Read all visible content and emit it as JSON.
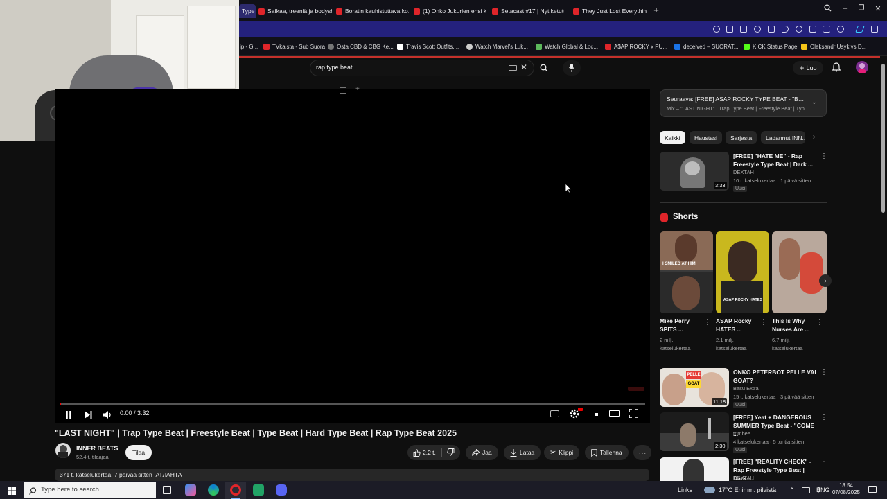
{
  "browser": {
    "tabs": [
      {
        "label": "Type",
        "active": true
      },
      {
        "label": "Safkaa, treeniä ja bodyshop"
      },
      {
        "label": "Boratin kauhistuttava ko..."
      },
      {
        "label": "(1) Onko Jukurien ensi ka..."
      },
      {
        "label": "Setacast #17 | Nyt ketuttaa"
      },
      {
        "label": "They Just Lost Everything"
      }
    ],
    "new_tab": "+",
    "bookmarks": [
      {
        "label": "ip - G...",
        "color": "#1a73e8"
      },
      {
        "label": "TVkaista - Sub Suora",
        "color": "#e0252a"
      },
      {
        "label": "Osta CBD & CBG Ke...",
        "color": "#777777"
      },
      {
        "label": "Travis Scott Outfits,...",
        "color": "#ffffff"
      },
      {
        "label": "Watch Marvel's Luk...",
        "color": "#cccccc"
      },
      {
        "label": "Watch Global & Loc...",
        "color": "#5cb85c"
      },
      {
        "label": "A$AP ROCKY x PU...",
        "color": "#e0252a"
      },
      {
        "label": "deceived – SUORAT...",
        "color": "#1a73e8"
      },
      {
        "label": "KICK Status Page",
        "color": "#53fc18"
      },
      {
        "label": "Oleksandr Usyk vs D...",
        "color": "#f5c518"
      }
    ]
  },
  "header": {
    "search_query": "rap type beat",
    "create_label": "Luo"
  },
  "player": {
    "time": "0:00 / 3:32",
    "progress": 0.0
  },
  "video": {
    "title": "\"LAST NIGHT\" | Trap Type Beat | Freestyle Beat | Type Beat | Hard Type Beat | Rap Type Beat 2025",
    "channel": "INNER BEATS",
    "subscribers": "52,4 t. tilaajaa",
    "subscribe_label": "Tilaa",
    "likes": "2,2 t.",
    "share_label": "Jaa",
    "download_label": "Lataa",
    "clip_label": "Klippi",
    "save_label": "Tallenna",
    "views_line": "371 t. katselukertaa  7 päivää sitten  АТЛАНТА"
  },
  "sidebar": {
    "upnext_title": "Seuraava: [FREE] ASAP ROCKY TYPE BEAT - \"BLAC...",
    "upnext_sub": "Mix – \"LAST NIGHT\" | Trap Type Beat | Freestyle Beat | Typ",
    "chips": [
      "Kaikki",
      "Haustasi",
      "Sarjasta",
      "Ladannut INN..."
    ],
    "first_video": {
      "title": "[FREE] \"HATE ME\" - Rap Freestyle Type Beat | Dark ...",
      "channel": "DEXTAH",
      "meta": "10 t. katselukertaa · 1 päivä sitten",
      "badge": "Uusi",
      "duration": "3:33"
    },
    "shorts_label": "Shorts",
    "shorts": [
      {
        "title": "Mike Perry SPITS ...",
        "views": "2 milj. katselukertaa",
        "overlay": "I SMILED AT HIM"
      },
      {
        "title": "ASAP Rocky HATES ...",
        "views": "2,1 milj. katselukertaa",
        "overlay": "ASAP ROCKY HATES"
      },
      {
        "title": "This Is Why Nurses Are ...",
        "views": "6,7 milj. katselukertaa",
        "overlay": ""
      }
    ],
    "videos": [
      {
        "title": "ONKO PETERBOT PELLE VAI GOAT?",
        "channel": "Basu Extra",
        "meta": "15 t. katselukertaa · 3 päivää sitten",
        "badge": "Uusi",
        "duration": "11:18",
        "thumb_text_1": "PELLE",
        "thumb_text_2": "GOAT"
      },
      {
        "title": "[FREE] Yeat + DANGEROUS SUMMER Type Beat - \"COME ...",
        "channel": "trimbee",
        "meta": "4 katselukertaa · 5 tuntia sitten",
        "badge": "Uusi",
        "duration": "2:30"
      },
      {
        "title": "[FREE] \"REALITY CHECK\" - Rap Freestyle Type Beat | Dark ...",
        "channel": "DEXTAH",
        "meta": "",
        "badge": "",
        "duration": ""
      }
    ]
  },
  "taskbar": {
    "search_placeholder": "Type here to search",
    "links_label": "Links",
    "weather": "17°C  Enimm. pilvistä",
    "language": "ENG",
    "time": "18.54",
    "date": "07/08/2025"
  }
}
